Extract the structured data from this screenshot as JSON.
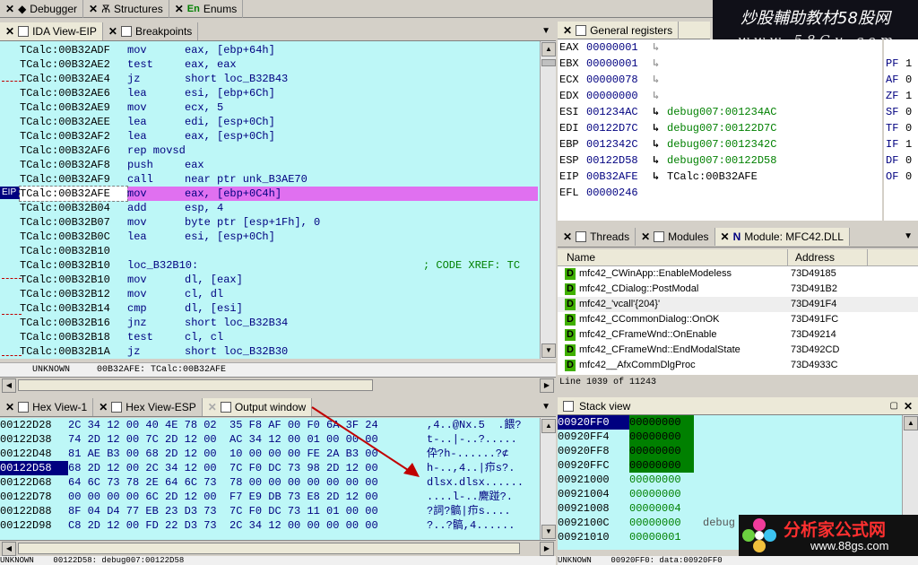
{
  "top_tabs": [
    {
      "label": "Debugger"
    },
    {
      "label": "Structures"
    },
    {
      "label": "Enums"
    }
  ],
  "watermark_top": {
    "line1": "炒股輔助教材58股网",
    "line2": "w w w . 5 8 G u . c o m"
  },
  "watermark_bottom": {
    "title": "分析家公式网",
    "url": "www.88gs.com"
  },
  "ida_tabs": [
    {
      "label": "IDA View-EIP"
    },
    {
      "label": "Breakpoints"
    }
  ],
  "disasm": [
    {
      "addr": "TCalc:00B32ADF",
      "mn": "mov",
      "op": "eax, [ebp+64h]"
    },
    {
      "addr": "TCalc:00B32AE2",
      "mn": "test",
      "op": "eax, eax"
    },
    {
      "addr": "TCalc:00B32AE4",
      "mn": "jz",
      "op": "short loc_B32B43"
    },
    {
      "addr": "TCalc:00B32AE6",
      "mn": "lea",
      "op": "esi, [ebp+6Ch]"
    },
    {
      "addr": "TCalc:00B32AE9",
      "mn": "mov",
      "op": "ecx, 5"
    },
    {
      "addr": "TCalc:00B32AEE",
      "mn": "lea",
      "op": "edi, [esp+0Ch]"
    },
    {
      "addr": "TCalc:00B32AF2",
      "mn": "lea",
      "op": "eax, [esp+0Ch]"
    },
    {
      "addr": "TCalc:00B32AF6",
      "mn": "rep movsd",
      "op": ""
    },
    {
      "addr": "TCalc:00B32AF8",
      "mn": "push",
      "op": "eax"
    },
    {
      "addr": "TCalc:00B32AF9",
      "mn": "call",
      "op": "near ptr unk_B3AE70"
    },
    {
      "addr": "TCalc:00B32AFE",
      "mn": "mov",
      "op": "eax, [ebp+0C4h]"
    },
    {
      "addr": "TCalc:00B32B04",
      "mn": "add",
      "op": "esp, 4"
    },
    {
      "addr": "TCalc:00B32B07",
      "mn": "mov",
      "op": "byte ptr [esp+1Fh], 0"
    },
    {
      "addr": "TCalc:00B32B0C",
      "mn": "lea",
      "op": "esi, [esp+0Ch]"
    },
    {
      "addr": "TCalc:00B32B10",
      "mn": "",
      "op": ""
    },
    {
      "addr": "TCalc:00B32B10",
      "mn": "loc_B32B10:",
      "op": "",
      "comment": "; CODE XREF: TC"
    },
    {
      "addr": "TCalc:00B32B10",
      "mn": "mov",
      "op": "dl, [eax]"
    },
    {
      "addr": "TCalc:00B32B12",
      "mn": "mov",
      "op": "cl, dl"
    },
    {
      "addr": "TCalc:00B32B14",
      "mn": "cmp",
      "op": "dl, [esi]"
    },
    {
      "addr": "TCalc:00B32B16",
      "mn": "jnz",
      "op": "short loc_B32B34"
    },
    {
      "addr": "TCalc:00B32B18",
      "mn": "test",
      "op": "cl, cl"
    },
    {
      "addr": "TCalc:00B32B1A",
      "mn": "jz",
      "op": "short loc_B32B30"
    }
  ],
  "eip_label": "EIP",
  "ida_status": {
    "left": "UNKNOWN",
    "right": "00B32AFE: TCalc:00B32AFE"
  },
  "registers_title": "General registers",
  "registers": [
    {
      "name": "EAX",
      "value": "00000001",
      "desc": ""
    },
    {
      "name": "EBX",
      "value": "00000001",
      "desc": ""
    },
    {
      "name": "ECX",
      "value": "00000078",
      "desc": ""
    },
    {
      "name": "EDX",
      "value": "00000000",
      "desc": ""
    },
    {
      "name": "ESI",
      "value": "001234AC",
      "desc": "debug007:001234AC"
    },
    {
      "name": "EDI",
      "value": "00122D7C",
      "desc": "debug007:00122D7C"
    },
    {
      "name": "EBP",
      "value": "0012342C",
      "desc": "debug007:0012342C"
    },
    {
      "name": "ESP",
      "value": "00122D58",
      "desc": "debug007:00122D58"
    },
    {
      "name": "EIP",
      "value": "00B32AFE",
      "desc": "TCalc:00B32AFE"
    },
    {
      "name": "EFL",
      "value": "00000246",
      "desc": ""
    }
  ],
  "flags": [
    {
      "name": "PF",
      "value": "1"
    },
    {
      "name": "AF",
      "value": "0"
    },
    {
      "name": "ZF",
      "value": "1"
    },
    {
      "name": "SF",
      "value": "0"
    },
    {
      "name": "TF",
      "value": "0"
    },
    {
      "name": "IF",
      "value": "1"
    },
    {
      "name": "DF",
      "value": "0"
    },
    {
      "name": "OF",
      "value": "0"
    }
  ],
  "module_tabs": [
    {
      "label": "Threads"
    },
    {
      "label": "Modules"
    },
    {
      "label": "Module: MFC42.DLL"
    }
  ],
  "module_columns": {
    "name": "Name",
    "address": "Address"
  },
  "module_rows": [
    {
      "name": "mfc42_CWinApp::EnableModeless",
      "address": "73D49185"
    },
    {
      "name": "mfc42_CDialog::PostModal",
      "address": "73D491B2"
    },
    {
      "name": "mfc42_'vcall'{204}'",
      "address": "73D491F4"
    },
    {
      "name": "mfc42_CCommonDialog::OnOK",
      "address": "73D491FC"
    },
    {
      "name": "mfc42_CFrameWnd::OnEnable",
      "address": "73D49214"
    },
    {
      "name": "mfc42_CFrameWnd::EndModalState",
      "address": "73D492CD"
    },
    {
      "name": "mfc42__AfxCommDlgProc",
      "address": "73D4933C"
    }
  ],
  "module_status": "Line 1039 of 11243",
  "hex_tabs": [
    {
      "label": "Hex View-1"
    },
    {
      "label": "Hex View-ESP"
    },
    {
      "label": "Output window"
    }
  ],
  "hex_rows": [
    {
      "addr": "00122D28",
      "bytes": "2C 34 12 00 40 4E 78 02  35 F8 AF 00 F0 6A 3F 24",
      "ascii": ",4..@Nx.5  .餵?"
    },
    {
      "addr": "00122D38",
      "bytes": "74 2D 12 00 7C 2D 12 00  AC 34 12 00 01 00 00 00",
      "ascii": "t-..|-..?....."
    },
    {
      "addr": "00122D48",
      "bytes": "81 AE B3 00 68 2D 12 00  10 00 00 00 FE 2A B3 00",
      "ascii": "伜?h-......?⊄"
    },
    {
      "addr": "00122D58",
      "bytes": "68 2D 12 00 2C 34 12 00  7C F0 DC 73 98 2D 12 00",
      "ascii": "h-..,4..|疖s?."
    },
    {
      "addr": "00122D68",
      "bytes": "64 6C 73 78 2E 64 6C 73  78 00 00 00 00 00 00 00",
      "ascii": "dlsx.dlsx......"
    },
    {
      "addr": "00122D78",
      "bytes": "00 00 00 00 6C 2D 12 00  F7 E9 DB 73 E8 2D 12 00",
      "ascii": "....l-..麍踫?."
    },
    {
      "addr": "00122D88",
      "bytes": "8F 04 D4 77 EB 23 D3 73  7C F0 DC 73 11 01 00 00",
      "ascii": "?詞?髇|疖s...."
    },
    {
      "addr": "00122D98",
      "bytes": "C8 2D 12 00 FD 22 D3 73  2C 34 12 00 00 00 00 00",
      "ascii": "?..?髇,4......"
    }
  ],
  "hex_status": {
    "left": "UNKNOWN",
    "right": "00122D58: debug007:00122D58"
  },
  "stack_title": "Stack view",
  "stack_rows": [
    {
      "addr": "00920FF0",
      "value": "00000000",
      "desc": ""
    },
    {
      "addr": "00920FF4",
      "value": "00000000",
      "desc": ""
    },
    {
      "addr": "00920FF8",
      "value": "00000000",
      "desc": ""
    },
    {
      "addr": "00920FFC",
      "value": "00000000",
      "desc": ""
    },
    {
      "addr": "00921000",
      "value": "00000000",
      "desc": ""
    },
    {
      "addr": "00921004",
      "value": "00000000",
      "desc": ""
    },
    {
      "addr": "00921008",
      "value": "00000004",
      "desc": ""
    },
    {
      "addr": "0092100C",
      "value": "00000000",
      "desc": "debug"
    },
    {
      "addr": "00921010",
      "value": "00000001",
      "desc": ""
    }
  ],
  "stack_status": {
    "left": "UNKNOWN",
    "right": "00920FF0: data:00920FF0"
  },
  "colors": {
    "highlight": "#e070f0",
    "cyan": "#bdf7f7",
    "selected": "#000080",
    "code_green": "#008000"
  }
}
